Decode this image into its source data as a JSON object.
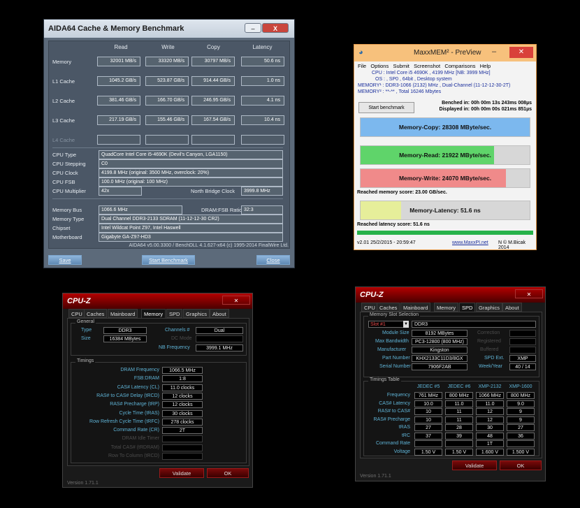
{
  "aida": {
    "title": "AIDA64 Cache & Memory Benchmark",
    "headers": [
      "Read",
      "Write",
      "Copy",
      "Latency"
    ],
    "rows": [
      {
        "label": "Memory",
        "values": [
          "32001 MB/s",
          "33320 MB/s",
          "30797 MB/s",
          "50.6 ns"
        ]
      },
      {
        "label": "L1 Cache",
        "values": [
          "1045.2 GB/s",
          "523.87 GB/s",
          "914.44 GB/s",
          "1.0 ns"
        ]
      },
      {
        "label": "L2 Cache",
        "values": [
          "381.46 GB/s",
          "166.70 GB/s",
          "246.95 GB/s",
          "4.1 ns"
        ]
      },
      {
        "label": "L3 Cache",
        "values": [
          "217.19 GB/s",
          "155.46 GB/s",
          "167.54 GB/s",
          "10.4 ns"
        ]
      },
      {
        "label": "L4 Cache",
        "values": [
          "",
          "",
          "",
          ""
        ]
      }
    ],
    "cpu_type_label": "CPU Type",
    "cpu_type": "QuadCore Intel Core i5-4690K  (Devil's Canyon, LGA1150)",
    "cpu_stepping_label": "CPU Stepping",
    "cpu_stepping": "C0",
    "cpu_clock_label": "CPU Clock",
    "cpu_clock": "4199.8 MHz  (original: 3500 MHz, overclock: 20%)",
    "cpu_fsb_label": "CPU FSB",
    "cpu_fsb": "100.0 MHz  (original: 100 MHz)",
    "cpu_mult_label": "CPU Multiplier",
    "cpu_mult": "42x",
    "nb_clock_label": "North Bridge Clock",
    "nb_clock": "3999.8 MHz",
    "mem_bus_label": "Memory Bus",
    "mem_bus": "1066.6 MHz",
    "dram_ratio_label": "DRAM:FSB Ratio",
    "dram_ratio": "32:3",
    "mem_type_label": "Memory Type",
    "mem_type": "Dual Channel DDR3-2133 SDRAM  (11-12-12-30 CR2)",
    "chipset_label": "Chipset",
    "chipset": "Intel Wildcat Point Z97, Intel Haswell",
    "mobo_label": "Motherboard",
    "mobo": "Gigabyte GA-Z97-HD3",
    "footer": "AIDA64 v5.00.3300 / BenchDLL 4.1.627-x64  (c) 1995-2014 FinalWire Ltd.",
    "save": "Save",
    "start": "Start Benchmark",
    "close": "Close",
    "min": "–",
    "x": "X"
  },
  "maxx": {
    "title": "MaxxMEM² - PreView",
    "menu": [
      "File",
      "Options",
      "Submit",
      "Screenshot",
      "Comparisons",
      "Help"
    ],
    "cpu_line": "CPU : Intel Core i5 4690K , 4199 MHz  [NB: 3999 MHz]",
    "os_line": "OS : , SP0 , 64bit , Desktop system",
    "mem1_line": "MEMORY¹ : DDR3-1066 (2132) MHz , Dual-Channel (11-12-12-30-2T)",
    "mem2_line": "MEMORY² : **-** , Total 16246 Mbytes",
    "start": "Start benchmark",
    "bench_in": "Benched in: 00h 00m 13s 243ms 008µs",
    "disp_in": "Displayed in: 00h 00m 00s 021ms 851µs",
    "copy": "Memory-Copy: 28308 MByte/sec.",
    "read": "Memory-Read: 21922 MByte/sec.",
    "write": "Memory-Write: 24070 MByte/sec.",
    "mem_score": "Reached memory score: 23.00 GB/sec.",
    "latency": "Memory-Latency: 51.6 ns",
    "lat_score": "Reached latency score: 51.6 ns",
    "status": "v2.01   25/2/2015 - 20:59:47",
    "link": "www.MaxxPI.net",
    "credit": "N   © M.Bicak 2014",
    "copy_frac": 1.0,
    "read_frac": 0.79,
    "write_frac": 0.86,
    "lat_frac": 0.24,
    "colors": {
      "copy": "#7cb8ee",
      "read": "#5fd46a",
      "write": "#f08a8a",
      "lat": "#e6ee9a"
    }
  },
  "cpuz_mem": {
    "name": "CPU-Z",
    "tabs": [
      "CPU",
      "Caches",
      "Mainboard",
      "Memory",
      "SPD",
      "Graphics",
      "About"
    ],
    "active": "Memory",
    "general": "General",
    "type_label": "Type",
    "type": "DDR3",
    "size_label": "Size",
    "size": "16384 MBytes",
    "channels_label": "Channels #",
    "channels": "Dual",
    "dc_label": "DC Mode",
    "dc": "",
    "nb_label": "NB Frequency",
    "nb": "3999.1 MHz",
    "timings": "Timings",
    "rows": [
      {
        "label": "DRAM Frequency",
        "value": "1066.5 MHz"
      },
      {
        "label": "FSB:DRAM",
        "value": "1:8"
      },
      {
        "label": "CAS# Latency (CL)",
        "value": "11.0 clocks"
      },
      {
        "label": "RAS# to CAS# Delay (tRCD)",
        "value": "12 clocks"
      },
      {
        "label": "RAS# Precharge (tRP)",
        "value": "12 clocks"
      },
      {
        "label": "Cycle Time (tRAS)",
        "value": "30 clocks"
      },
      {
        "label": "Row Refresh Cycle Time (tRFC)",
        "value": "278 clocks"
      },
      {
        "label": "Command Rate (CR)",
        "value": "2T"
      },
      {
        "label": "DRAM Idle Timer",
        "value": ""
      },
      {
        "label": "Total CAS# (tRDRAM)",
        "value": ""
      },
      {
        "label": "Row To Column (tRCD)",
        "value": ""
      }
    ],
    "validate": "Validate",
    "ok": "OK",
    "version": "Version 1.71.1"
  },
  "cpuz_spd": {
    "name": "CPU-Z",
    "tabs": [
      "CPU",
      "Caches",
      "Mainboard",
      "Memory",
      "SPD",
      "Graphics",
      "About"
    ],
    "active": "SPD",
    "slot_group": "Memory Slot Selection",
    "slot": "Slot #1",
    "slot_type": "DDR3",
    "module_size_label": "Module Size",
    "module_size": "8192 MBytes",
    "max_bw_label": "Max Bandwidth",
    "max_bw": "PC3-12800 (800 MHz)",
    "mfr_label": "Manufacturer",
    "mfr": "Kingston",
    "part_label": "Part Number",
    "part": "KHX2133C11D3/8GX",
    "serial_label": "Serial Number",
    "serial": "7906F2AB",
    "correction": "Correction",
    "registered": "Registered",
    "buffered": "Buffered",
    "spd_ext_label": "SPD Ext.",
    "spd_ext": "XMP",
    "week_label": "Week/Year",
    "week": "40 / 14",
    "timings_group": "Timings Table",
    "cols": [
      "JEDEC #5",
      "JEDEC #6",
      "XMP-2132",
      "XMP-1600"
    ],
    "trows": [
      {
        "label": "Frequency",
        "values": [
          "761 MHz",
          "800 MHz",
          "1066 MHz",
          "800 MHz"
        ]
      },
      {
        "label": "CAS# Latency",
        "values": [
          "10.0",
          "11.0",
          "11.0",
          "9.0"
        ]
      },
      {
        "label": "RAS# to CAS#",
        "values": [
          "10",
          "11",
          "12",
          "9"
        ]
      },
      {
        "label": "RAS# Precharge",
        "values": [
          "10",
          "11",
          "12",
          "9"
        ]
      },
      {
        "label": "tRAS",
        "values": [
          "27",
          "28",
          "30",
          "27"
        ]
      },
      {
        "label": "tRC",
        "values": [
          "37",
          "39",
          "48",
          "36"
        ]
      },
      {
        "label": "Command Rate",
        "values": [
          "",
          "",
          "1T",
          ""
        ]
      },
      {
        "label": "Voltage",
        "values": [
          "1.50 V",
          "1.50 V",
          "1.600 V",
          "1.500 V"
        ]
      }
    ],
    "validate": "Validate",
    "ok": "OK",
    "version": "Version 1.71.1"
  }
}
